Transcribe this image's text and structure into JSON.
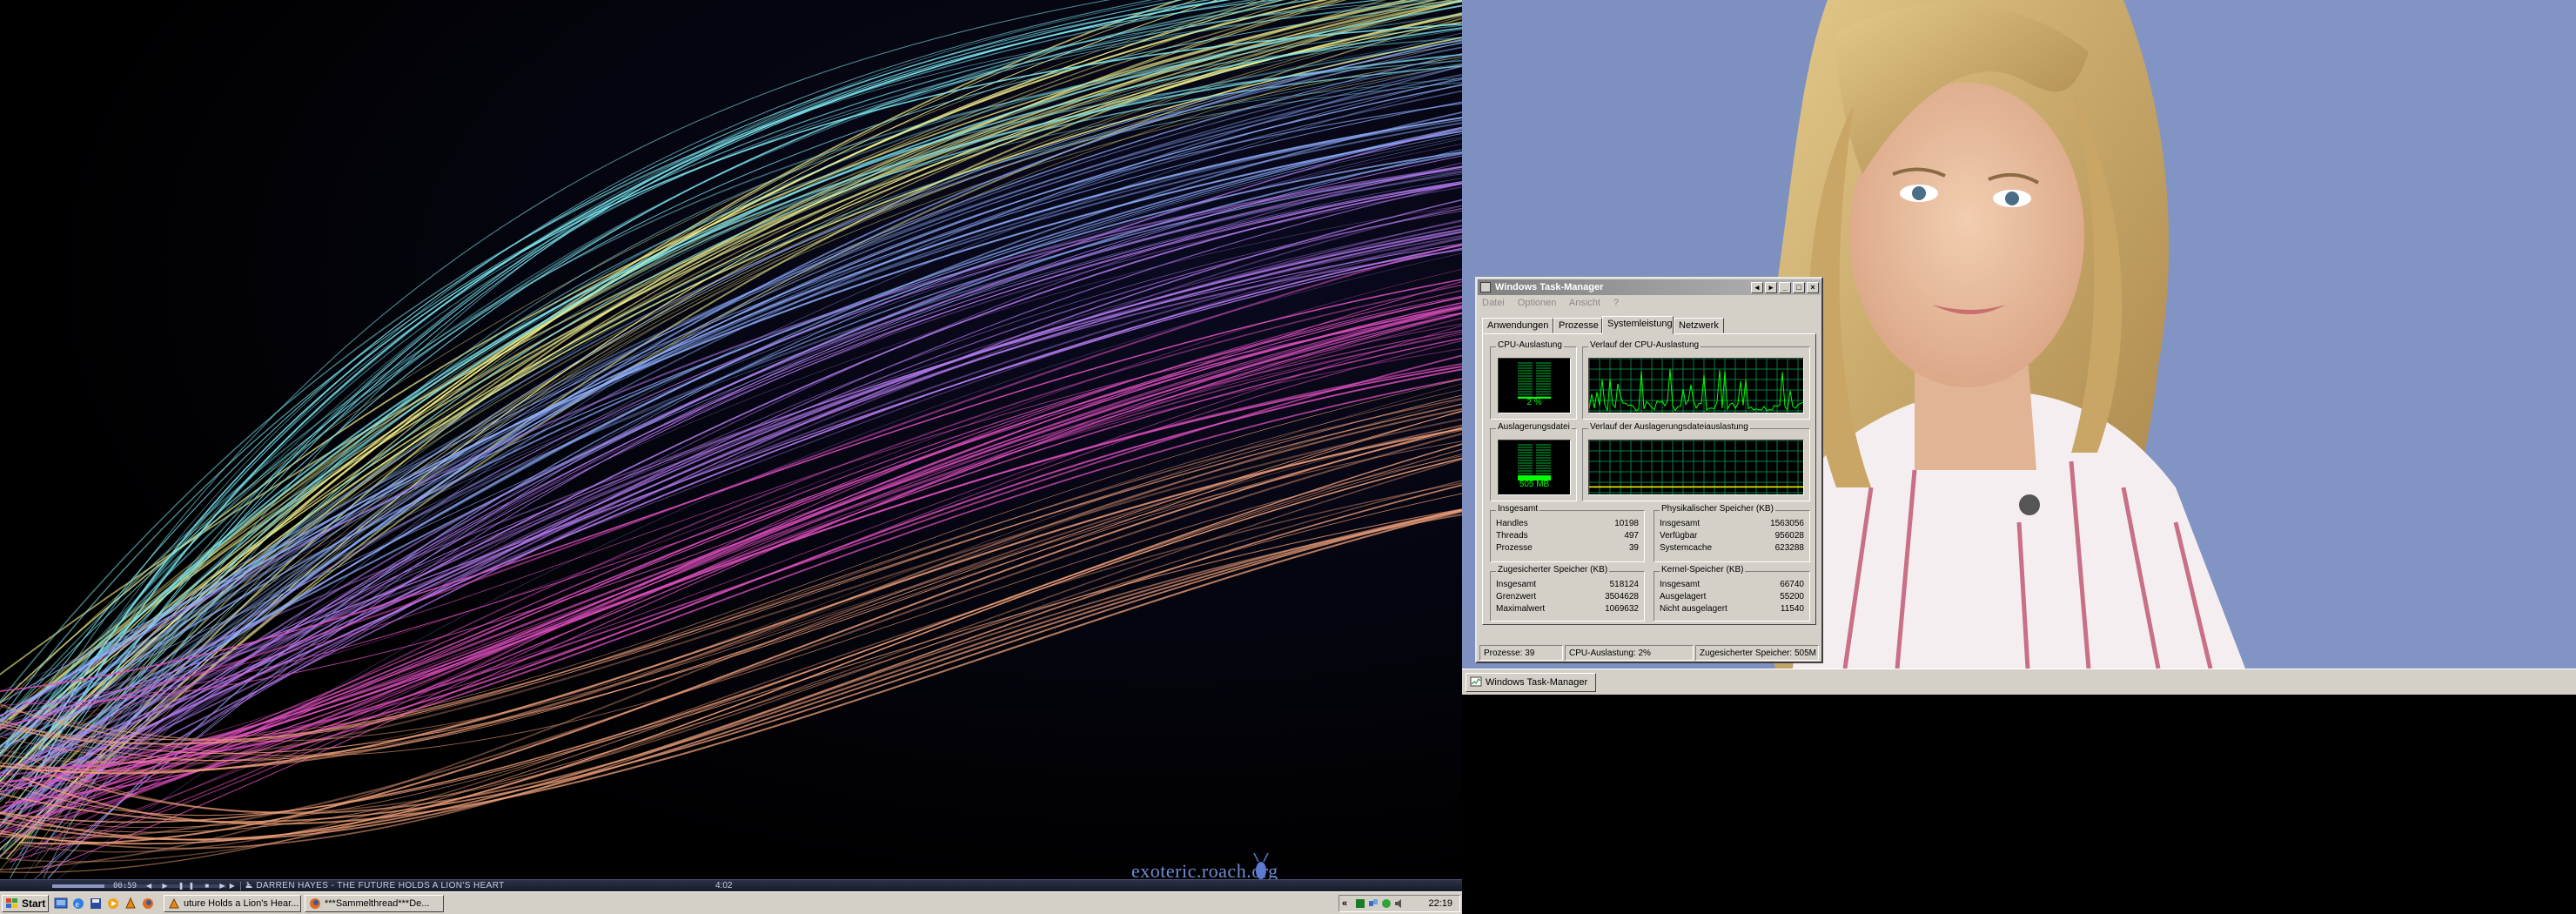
{
  "left_screen": {
    "wallpaper_credit": "exoteric.roach.org",
    "media_player": {
      "elapsed": "00:59",
      "progress": 0.3,
      "track_title": "1. DARREN HAYES - THE FUTURE HOLDS A LION'S HEART",
      "track_length": "4:02"
    },
    "taskbar": {
      "start_label": "Start",
      "quick_launch_icons": [
        "show-desktop-icon",
        "internet-explorer-icon",
        "save-disk-icon",
        "media-player-icon",
        "winamp-icon",
        "firefox-icon"
      ],
      "tasks": [
        {
          "label": "uture Holds a Lion's Hear...",
          "icon": "winamp-icon"
        },
        {
          "label": "***Sammelthread***De...",
          "icon": "firefox-icon"
        }
      ],
      "clock": "22:19"
    }
  },
  "right_screen": {
    "taskbar": {
      "tasks": [
        {
          "label": "Windows Task-Manager",
          "icon": "task-manager-icon"
        }
      ]
    },
    "task_manager": {
      "title": "Windows Task-Manager",
      "menu": [
        "Datei",
        "Optionen",
        "Ansicht",
        "?"
      ],
      "tabs": [
        "Anwendungen",
        "Prozesse",
        "Systemleistung",
        "Netzwerk"
      ],
      "active_tab": "Systemleistung",
      "cpu_usage_label": "CPU-Auslastung",
      "cpu_usage_value": "2 %",
      "cpu_usage_fraction": 0.02,
      "cpu_history_label": "Verlauf der CPU-Auslastung",
      "pagefile_label": "Auslagerungsdatei",
      "pagefile_value": "505 MB",
      "pagefile_fraction": 0.14,
      "pagefile_history_label": "Verlauf der Auslagerungsdateiauslastung",
      "totals": {
        "title": "Insgesamt",
        "rows": [
          {
            "k": "Handles",
            "v": "10198"
          },
          {
            "k": "Threads",
            "v": "497"
          },
          {
            "k": "Prozesse",
            "v": "39"
          }
        ]
      },
      "physical": {
        "title": "Physikalischer Speicher (KB)",
        "rows": [
          {
            "k": "Insgesamt",
            "v": "1563056"
          },
          {
            "k": "Verfügbar",
            "v": "956028"
          },
          {
            "k": "Systemcache",
            "v": "623288"
          }
        ]
      },
      "commit": {
        "title": "Zugesicherter Speicher (KB)",
        "rows": [
          {
            "k": "Insgesamt",
            "v": "518124"
          },
          {
            "k": "Grenzwert",
            "v": "3504628"
          },
          {
            "k": "Maximalwert",
            "v": "1069632"
          }
        ]
      },
      "kernel": {
        "title": "Kernel-Speicher (KB)",
        "rows": [
          {
            "k": "Insgesamt",
            "v": "66740"
          },
          {
            "k": "Ausgelagert",
            "v": "55200"
          },
          {
            "k": "Nicht ausgelagert",
            "v": "11540"
          }
        ]
      },
      "status": {
        "processes": "Prozesse: 39",
        "cpu": "CPU-Auslastung: 2%",
        "commit": "Zugesicherter Speicher: 505M"
      }
    }
  },
  "colors": {
    "taskbar": "#d4d0c8",
    "graph_green": "#00ff00",
    "grid_green": "#008040"
  }
}
